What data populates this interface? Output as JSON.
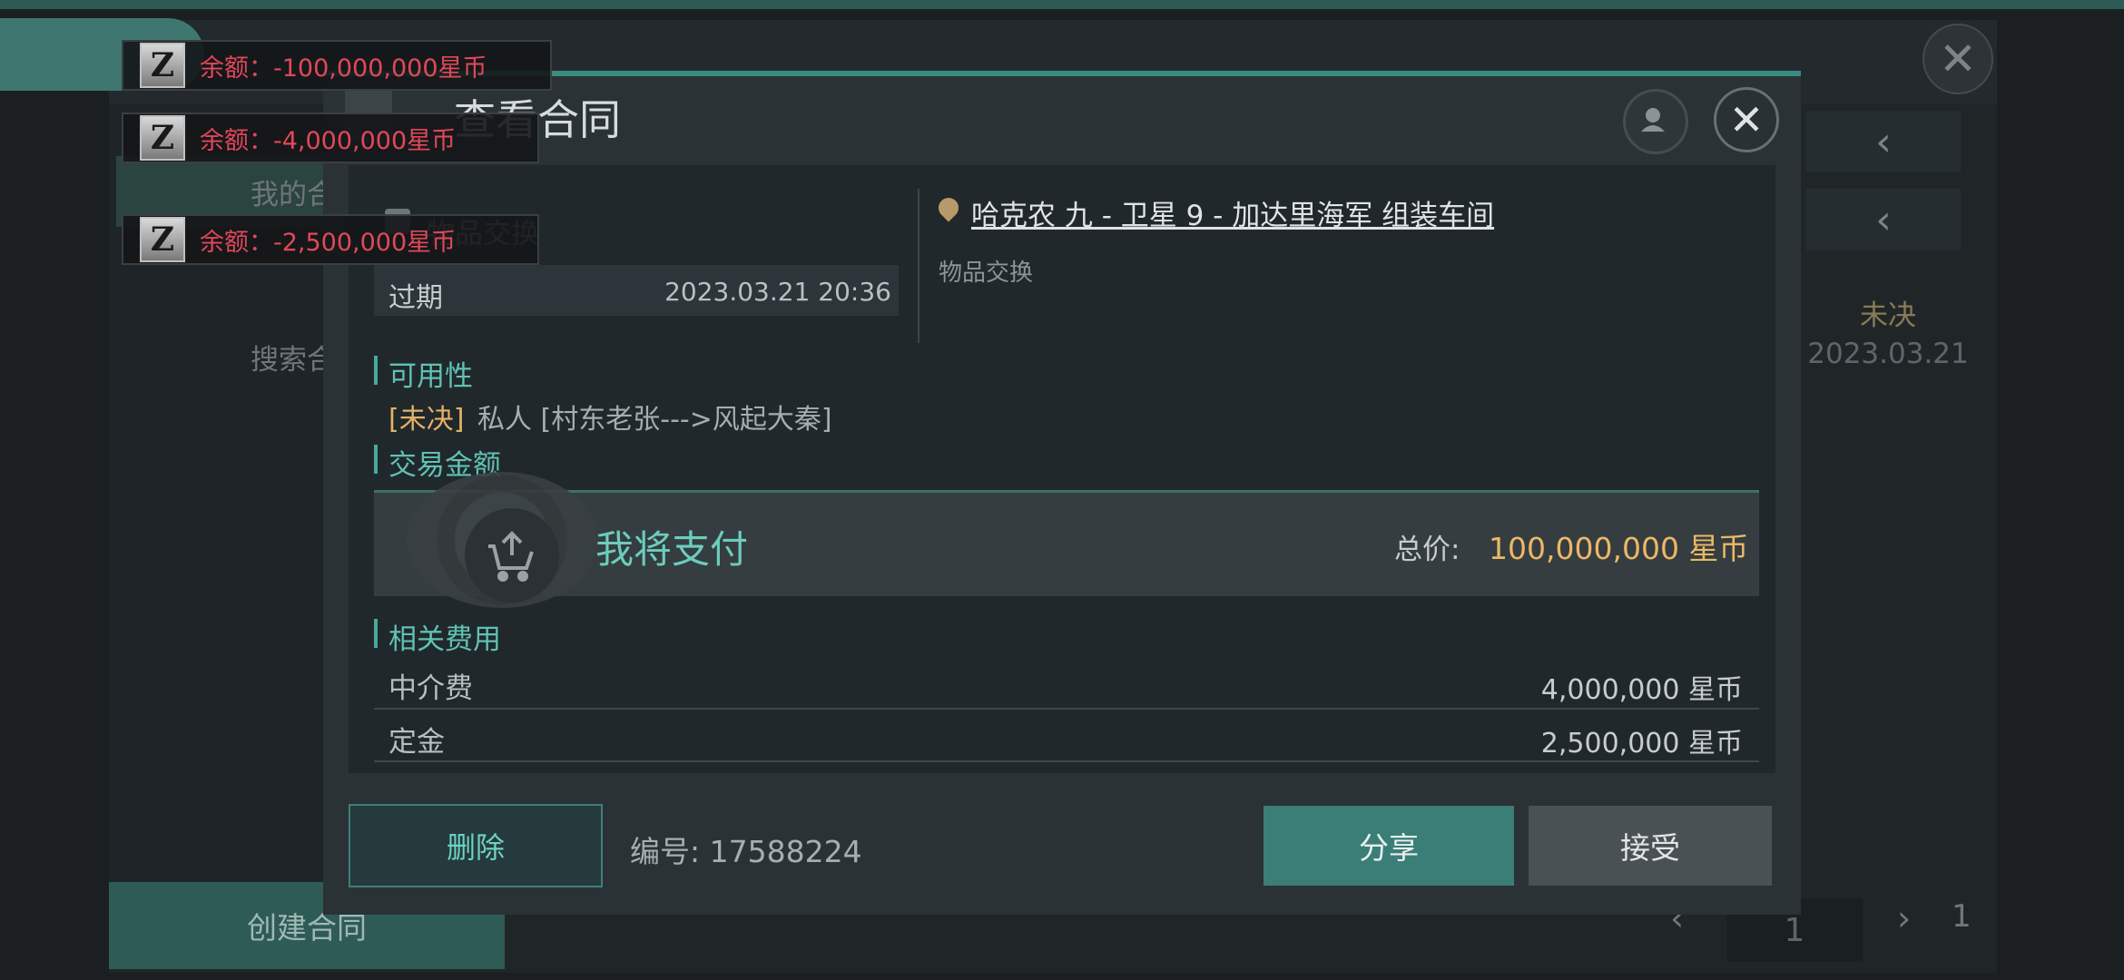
{
  "background": {
    "sidebar": {
      "my_contracts": "我的合同",
      "search_contracts": "搜索合同",
      "create": "创建合同"
    },
    "list": {
      "status": "未决",
      "date": "2023.03.21"
    },
    "pager": {
      "current": "1",
      "total": "1"
    }
  },
  "toasts": [
    {
      "label": "余额：-100,000,000星币"
    },
    {
      "label": "余额：-4,000,000星币"
    },
    {
      "label": "余额：-2,500,000星币"
    }
  ],
  "dialog": {
    "title": "查看合同",
    "item_type": "物品交换",
    "expire": {
      "label": "过期",
      "value": "2023.03.21 20:36"
    },
    "location": {
      "name": "哈克农 九 - 卫星 9 - 加达里海军 组装车间",
      "sub": "物品交换"
    },
    "availability": {
      "title": "可用性",
      "status": "[未决]",
      "text": "私人 [村东老张--->风起大秦]"
    },
    "amount": {
      "title": "交易金额",
      "pay_label": "我将支付",
      "total_label": "总价:",
      "total_value": "100,000,000 星币"
    },
    "fees": {
      "title": "相关费用",
      "rows": [
        {
          "label": "中介费",
          "value": "4,000,000 星币"
        },
        {
          "label": "定金",
          "value": "2,500,000 星币"
        }
      ]
    },
    "footer": {
      "delete": "删除",
      "contract_no": "编号: 17588224",
      "share": "分享",
      "accept": "接受"
    }
  },
  "colors": {
    "accent": "#3a8c82",
    "pending": "#e2b267",
    "negative": "#e2475a",
    "price": "#ebb865"
  },
  "icons": [
    "z-currency-icon",
    "location-pin-icon",
    "user-icon",
    "close-icon",
    "cart-upload-icon"
  ]
}
